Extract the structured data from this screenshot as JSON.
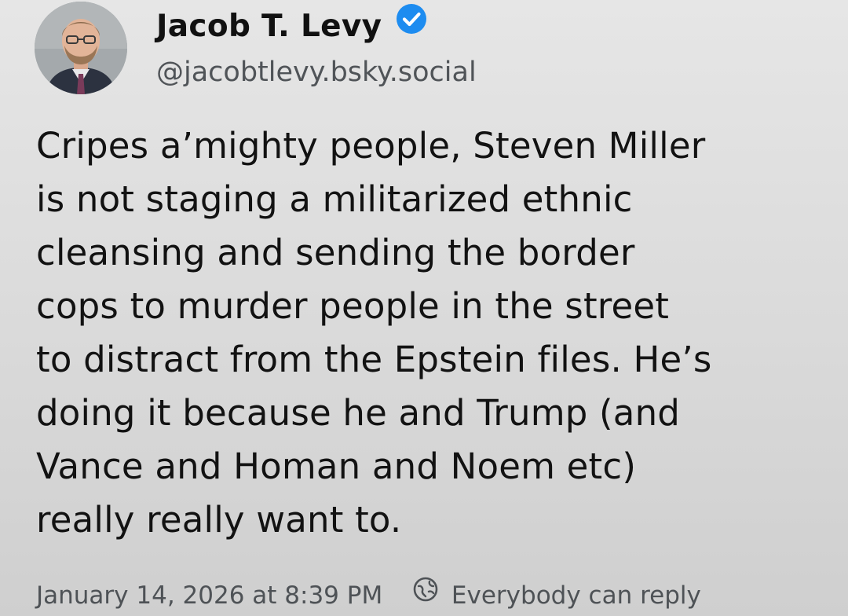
{
  "author": {
    "name": "Jacob T. Levy",
    "handle": "@jacobtlevy.bsky.social",
    "verified_icon": "verified-check-icon",
    "verified_color": "#1d8cf0",
    "avatar": "person-avatar-photo"
  },
  "post": {
    "lines": [
      "Cripes a’mighty people, Steven Miller",
      "is not staging a militarized ethnic",
      "cleansing and sending the border",
      "cops to murder people in the street",
      "to distract from the Epstein files. He’s",
      "doing it because he and Trump (and",
      "Vance and Homan and Noem etc)",
      "really really want to."
    ]
  },
  "meta": {
    "timestamp": "January 14, 2026 at 8:39 PM",
    "reply_icon": "globe-reply-icon",
    "reply_setting": "Everybody can reply"
  }
}
